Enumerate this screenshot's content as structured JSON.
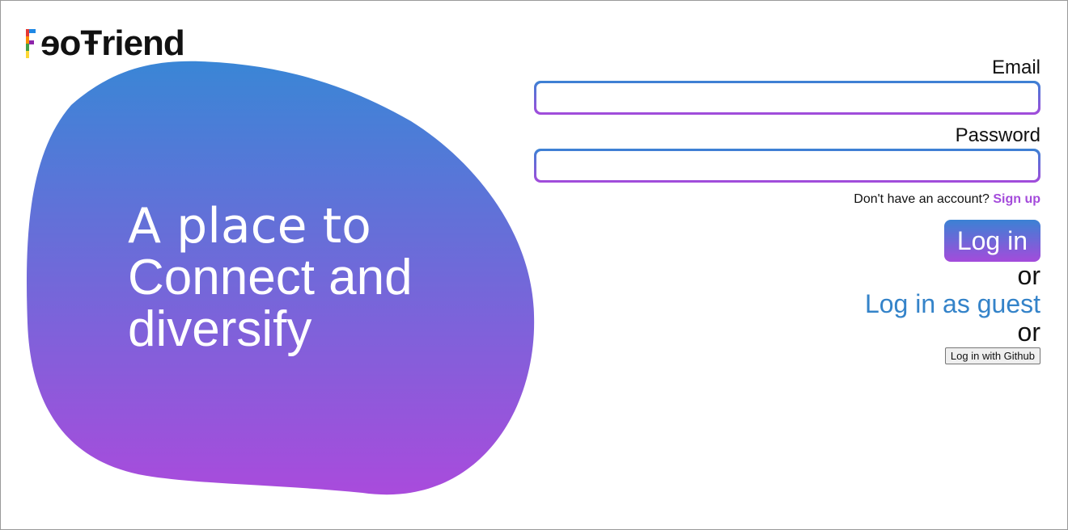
{
  "app": {
    "logo_text": "ɘoŦriend"
  },
  "hero": {
    "line1": "A place to",
    "line2": "Connect and",
    "line3": "diversify"
  },
  "form": {
    "email_label": "Email",
    "email_value": "",
    "password_label": "Password",
    "password_value": "",
    "signup_prompt": "Don't have an account?",
    "signup_link": "Sign up",
    "login_label": "Log in",
    "or_1": "or",
    "guest_label": "Log in as guest",
    "or_2": "or",
    "github_label": "Log in with Github"
  },
  "colors": {
    "gradient_top": "#3b82d4",
    "gradient_bottom": "#a44bdb",
    "link_blue": "#3483c9",
    "signup_purple": "#a44bdb"
  }
}
